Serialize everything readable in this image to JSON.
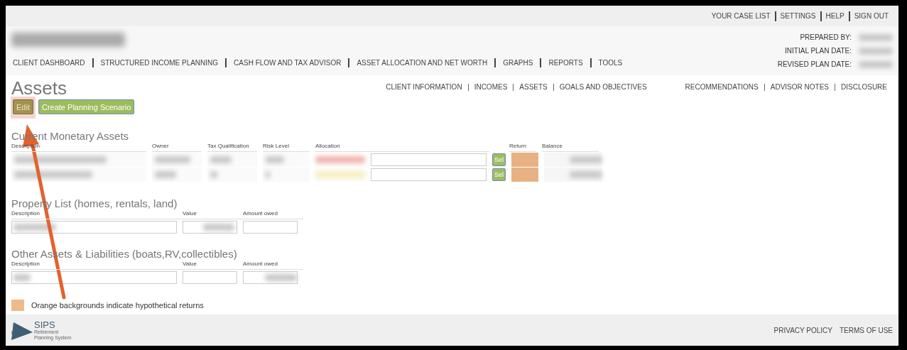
{
  "top_links": [
    "YOUR CASE LIST",
    "SETTINGS",
    "HELP",
    "SIGN OUT"
  ],
  "main_nav": [
    "CLIENT DASHBOARD",
    "STRUCTURED INCOME PLANNING",
    "CASH FLOW AND TAX ADVISOR",
    "ASSET ALLOCATION AND NET WORTH",
    "GRAPHS",
    "REPORTS",
    "TOOLS"
  ],
  "plan_info": [
    "PREPARED BY:",
    "INITIAL PLAN DATE:",
    "REVISED PLAN DATE:"
  ],
  "page_title": "Assets",
  "sub_nav_left": [
    "CLIENT INFORMATION",
    "INCOMES",
    "ASSETS",
    "GOALS AND OBJECTIVES"
  ],
  "sub_nav_right": [
    "RECOMMENDATIONS",
    "ADVISOR NOTES",
    "DISCLOSURE"
  ],
  "actions": [
    {
      "label": "Edit",
      "kind": "edit"
    },
    {
      "label": "Create Planning Scenario",
      "kind": "create"
    }
  ],
  "monetary": {
    "title": "Current Monetary Assets",
    "columns": [
      "Description",
      "Owner",
      "Tax Qualification",
      "Risk Level",
      "Allocation",
      "Return",
      "Balance"
    ],
    "rows": [
      {
        "select_label": "Sel",
        "hypothetical": true
      },
      {
        "select_label": "Sel",
        "hypothetical": true
      }
    ]
  },
  "property": {
    "title": "Property List (homes, rentals, land)",
    "columns": [
      "Description",
      "Value",
      "Amount owed"
    ]
  },
  "other": {
    "title": "Other Assets & Liabilities (boats,RV,collectibles)",
    "columns": [
      "Description",
      "Value",
      "Amount owed"
    ]
  },
  "legend": "Orange backgrounds indicate hypothetical returns",
  "footer": {
    "logo": "SIPS",
    "logo_sub": "Retirement Planning System",
    "links": [
      "PRIVACY POLICY",
      "TERMS OF USE"
    ]
  }
}
